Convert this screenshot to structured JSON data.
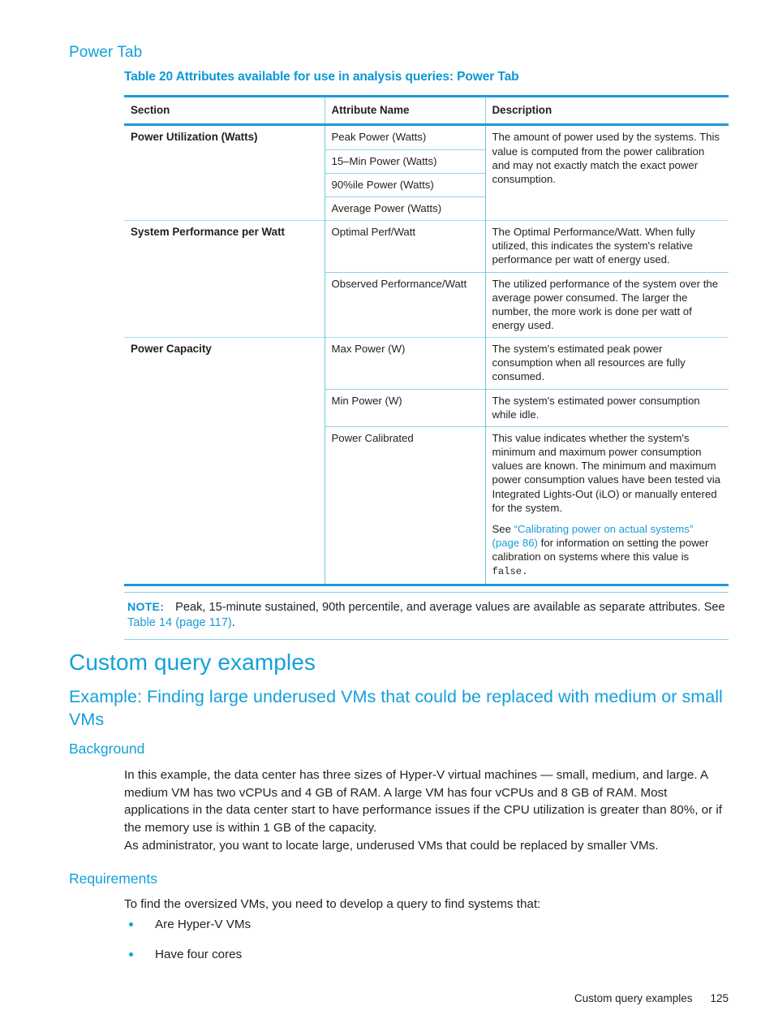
{
  "page": {
    "section_heading": "Power Tab",
    "footer_text": "Custom query examples",
    "footer_page_number": "125"
  },
  "colors": {
    "accent_blue": "#12A0DB",
    "rule_blue": "#1B9BD8",
    "light_rule_blue": "#8FCFEC",
    "body_text": "#231f20"
  },
  "table": {
    "caption": "Table 20 Attributes available for use in analysis queries: Power Tab",
    "headers": [
      "Section",
      "Attribute Name",
      "Description"
    ],
    "sections": [
      {
        "section": "Power Utilization (Watts)",
        "rows": [
          {
            "attribute": "Peak Power (Watts)",
            "description": "The amount of power used by the systems. This value is computed from the power calibration and may not exactly match the exact power consumption.",
            "description_rowspan": 4
          },
          {
            "attribute": "15–Min Power (Watts)"
          },
          {
            "attribute": "90%ile Power (Watts)"
          },
          {
            "attribute": "Average Power (Watts)"
          }
        ]
      },
      {
        "section": "System Performance per Watt",
        "rows": [
          {
            "attribute": "Optimal Perf/Watt",
            "description": "The Optimal Performance/Watt. When fully utilized, this indicates the system's relative performance per watt of energy used."
          },
          {
            "attribute": "Observed Performance/Watt",
            "description": "The utilized performance of the system over the average power consumed. The larger the number, the more work is done per watt of energy used."
          }
        ]
      },
      {
        "section": "Power Capacity",
        "rows": [
          {
            "attribute": "Max Power (W)",
            "description": "The system's estimated peak power consumption when all resources are fully consumed."
          },
          {
            "attribute": "Min Power (W)",
            "description": "The system's estimated power consumption while idle."
          },
          {
            "attribute": "Power Calibrated",
            "description": "This value indicates whether the system's minimum and maximum power consumption values are known. The minimum and maximum power consumption values have been tested via Integrated Lights-Out (iLO) or manually entered for the system.",
            "description_2_prefix": "See ",
            "description_2_link": "“Calibrating power on actual systems” (page 86)",
            "description_2_mid": " for information on setting the power calibration on systems where this value is ",
            "description_2_code": "false",
            "description_2_suffix": "."
          }
        ]
      }
    ]
  },
  "note": {
    "label": "NOTE:",
    "text_before_link": "Peak, 15-minute sustained, 90th percentile, and average values are available as separate attributes. See ",
    "link": "Table 14 (page 117)",
    "text_after_link": "."
  },
  "custom_query": {
    "h1": "Custom query examples",
    "h2": "Example: Finding large underused VMs that could be replaced with medium or small VMs",
    "background_heading": "Background",
    "background_p1": "In this example, the data center has three sizes of Hyper-V virtual machines — small, medium, and large. A medium VM has two vCPUs and 4 GB of RAM. A large VM has four vCPUs and 8 GB of RAM. Most applications in the data center start to have performance issues if the CPU utilization is greater than 80%, or if the memory use is within 1 GB of the capacity.",
    "background_p2": "As administrator, you want to locate large, underused VMs that could be replaced by smaller VMs.",
    "requirements_heading": "Requirements",
    "requirements_intro": "To find the oversized VMs, you need to develop a query to find systems that:",
    "requirements_bullets": [
      "Are Hyper-V VMs",
      "Have four cores"
    ]
  }
}
